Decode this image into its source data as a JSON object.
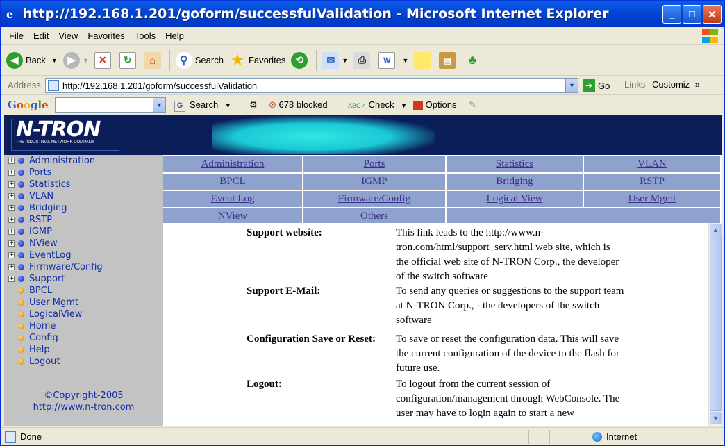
{
  "window": {
    "title": "http://192.168.1.201/goform/successfulValidation - Microsoft Internet Explorer"
  },
  "menu": [
    "File",
    "Edit",
    "View",
    "Favorites",
    "Tools",
    "Help"
  ],
  "toolbar": {
    "back": "Back",
    "search": "Search",
    "favorites": "Favorites"
  },
  "address": {
    "label": "Address",
    "url": "http://192.168.1.201/goform/successfulValidation",
    "go": "Go",
    "links": "Links",
    "customize": "Customiz"
  },
  "google": {
    "logo": "Google",
    "search": "Search",
    "blocked": "678 blocked",
    "check": "Check",
    "options": "Options"
  },
  "banner": {
    "logo_big": "N-TRON",
    "logo_small": "THE INDUSTRIAL NETWORK COMPANY"
  },
  "sidebar": {
    "folders": [
      "Administration",
      "Ports",
      "Statistics",
      "VLAN",
      "Bridging",
      "RSTP",
      "IGMP",
      "NView",
      "EventLog",
      "Firmware/Config",
      "Support"
    ],
    "pages": [
      "BPCL",
      "User Mgmt",
      "LogicalView",
      "Home",
      "Config",
      "Help",
      "Logout"
    ],
    "copyright_line1": "©Copyright-2005",
    "copyright_line2": "http://www.n-tron.com"
  },
  "nav": {
    "row1": [
      "Administration",
      "Ports",
      "Statistics",
      "VLAN"
    ],
    "row2": [
      "BPCL",
      "IGMP",
      "Bridging",
      "RSTP"
    ],
    "row3": [
      "Event Log",
      "Firmware/Config",
      "Logical View",
      "User Mgmt"
    ],
    "row4": [
      "NView",
      "Others"
    ]
  },
  "main": {
    "rows": [
      {
        "key": "Support website:",
        "value": "This link leads to the http://www.n-tron.com/html/support_serv.html web site, which is the official web site of N-TRON Corp., the developer of the switch software"
      },
      {
        "key": "Support E-Mail:",
        "value": "To send any queries or suggestions to the support team at N-TRON Corp., - the developers of the switch software"
      },
      {
        "key": "Configuration Save or Reset:",
        "value": "To save or reset the configuration data. This will save the current configuration of the device to the flash for future use."
      },
      {
        "key": "Logout:",
        "value": "To logout from the current session of configuration/management through WebConsole. The user may have to login again to start a new"
      }
    ]
  },
  "status": {
    "text": "Done",
    "zone": "Internet"
  }
}
